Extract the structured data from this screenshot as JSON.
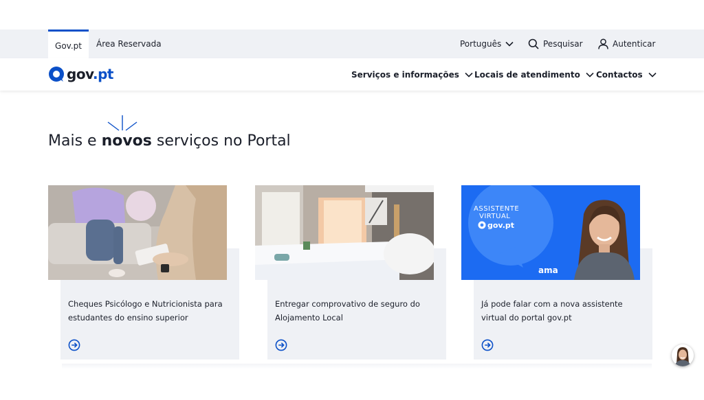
{
  "topbar": {
    "tabs": [
      {
        "label": "Gov.pt"
      },
      {
        "label": "Área Reservada"
      }
    ],
    "language": "Português",
    "search": "Pesquisar",
    "login": "Autenticar"
  },
  "mainnav": {
    "logo_a": "gov",
    "logo_b": ".pt",
    "items": [
      {
        "label": "Serviços e informações"
      },
      {
        "label": "Locais de atendimento"
      },
      {
        "label": "Contactos"
      }
    ]
  },
  "hero": {
    "heading_pre": "Mais e ",
    "heading_bold": "novos",
    "heading_post": " serviços no Portal"
  },
  "cards": [
    {
      "text": "Cheques Psicólogo e Nutricionista para estudantes do ensino superior"
    },
    {
      "text": "Entregar comprovativo de seguro do Alojamento Local"
    },
    {
      "text": "Já pode falar com a nova assistente virtual do portal gov.pt",
      "image_text_1": "ASSISTENTE",
      "image_text_2": "VIRTUAL",
      "image_logo": "gov.pt",
      "image_brand": "ama"
    }
  ],
  "colors": {
    "accent": "#0b50c8",
    "panel": "#eff1f5",
    "text": "#1b1f2a"
  }
}
